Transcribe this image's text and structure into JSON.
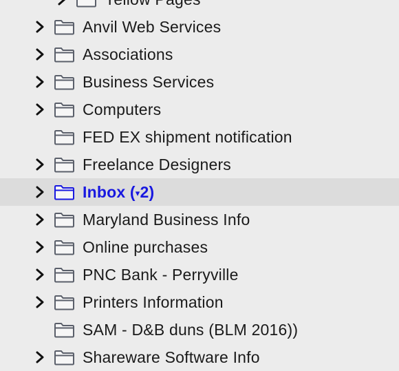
{
  "folders": [
    {
      "label": "Yellow Pages",
      "has_children": true,
      "nested": true
    },
    {
      "label": "Anvil Web Services",
      "has_children": true
    },
    {
      "label": "Associations",
      "has_children": true
    },
    {
      "label": "Business Services",
      "has_children": true
    },
    {
      "label": "Computers",
      "has_children": true
    },
    {
      "label": "FED EX shipment notification",
      "has_children": false
    },
    {
      "label": "Freelance Designers",
      "has_children": true
    },
    {
      "label": "Inbox",
      "has_children": true,
      "selected": true,
      "badge_arrow": "▾",
      "badge_count": "2"
    },
    {
      "label": "Maryland Business Info",
      "has_children": true
    },
    {
      "label": "Online purchases",
      "has_children": true
    },
    {
      "label": "PNC Bank - Perryville",
      "has_children": true
    },
    {
      "label": "Printers Information",
      "has_children": true
    },
    {
      "label": "SAM - D&B duns (BLM 2016))",
      "has_children": false
    },
    {
      "label": "Shareware Software Info",
      "has_children": true
    }
  ],
  "colors": {
    "background": "#ececec",
    "selected_row": "#dcdcdc",
    "selected_text": "#1818e0",
    "folder_stroke": "#5a5f6a",
    "folder_fill": "#f6f6f6"
  }
}
